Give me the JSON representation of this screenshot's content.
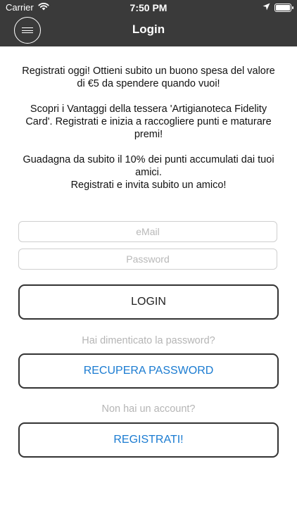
{
  "status_bar": {
    "carrier": "Carrier",
    "time": "7:50 PM",
    "icons": [
      "wifi-icon",
      "location-arrow-icon",
      "battery-icon"
    ]
  },
  "header": {
    "title": "Login",
    "menu_icon": "hamburger-menu-icon"
  },
  "intro": {
    "paragraph1": "Registrati oggi! Ottieni subito un buono spesa del valore di €5 da spendere quando vuoi!",
    "paragraph2": "Scopri i Vantaggi della tessera 'Artigianoteca Fidelity Card'. Registrati e inizia a raccogliere punti e maturare premi!",
    "paragraph3_line1": "Guadagna da subito il 10% dei punti accumulati dai tuoi amici.",
    "paragraph3_line2": "Registrati e invita subito un amico!"
  },
  "form": {
    "email_placeholder": "eMail",
    "email_value": "",
    "password_placeholder": "Password",
    "password_value": "",
    "login_label": "LOGIN"
  },
  "recover": {
    "hint": "Hai dimenticato la password?",
    "button_label": "RECUPERA PASSWORD"
  },
  "register": {
    "hint": "Non hai un account?",
    "button_label": "REGISTRATI!"
  },
  "colors": {
    "header_bg": "#3a3a3a",
    "link_blue": "#1a7bd1",
    "hint_gray": "#b5b5b5"
  }
}
